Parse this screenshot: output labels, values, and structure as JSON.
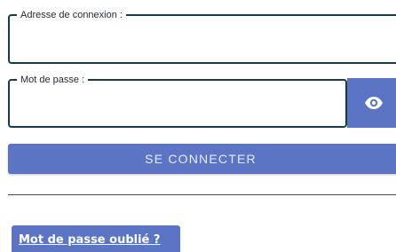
{
  "login": {
    "legend": "Adresse de connexion :",
    "value": "",
    "placeholder": ""
  },
  "password": {
    "legend": "Mot de passe :",
    "value": "",
    "placeholder": "",
    "toggle_icon": "eye-icon"
  },
  "actions": {
    "connect_label": "SE CONNECTER",
    "forgot_label": "Mot de passe oublié ?"
  },
  "colors": {
    "accent": "#5b74c4",
    "field_border": "#163a4a"
  }
}
